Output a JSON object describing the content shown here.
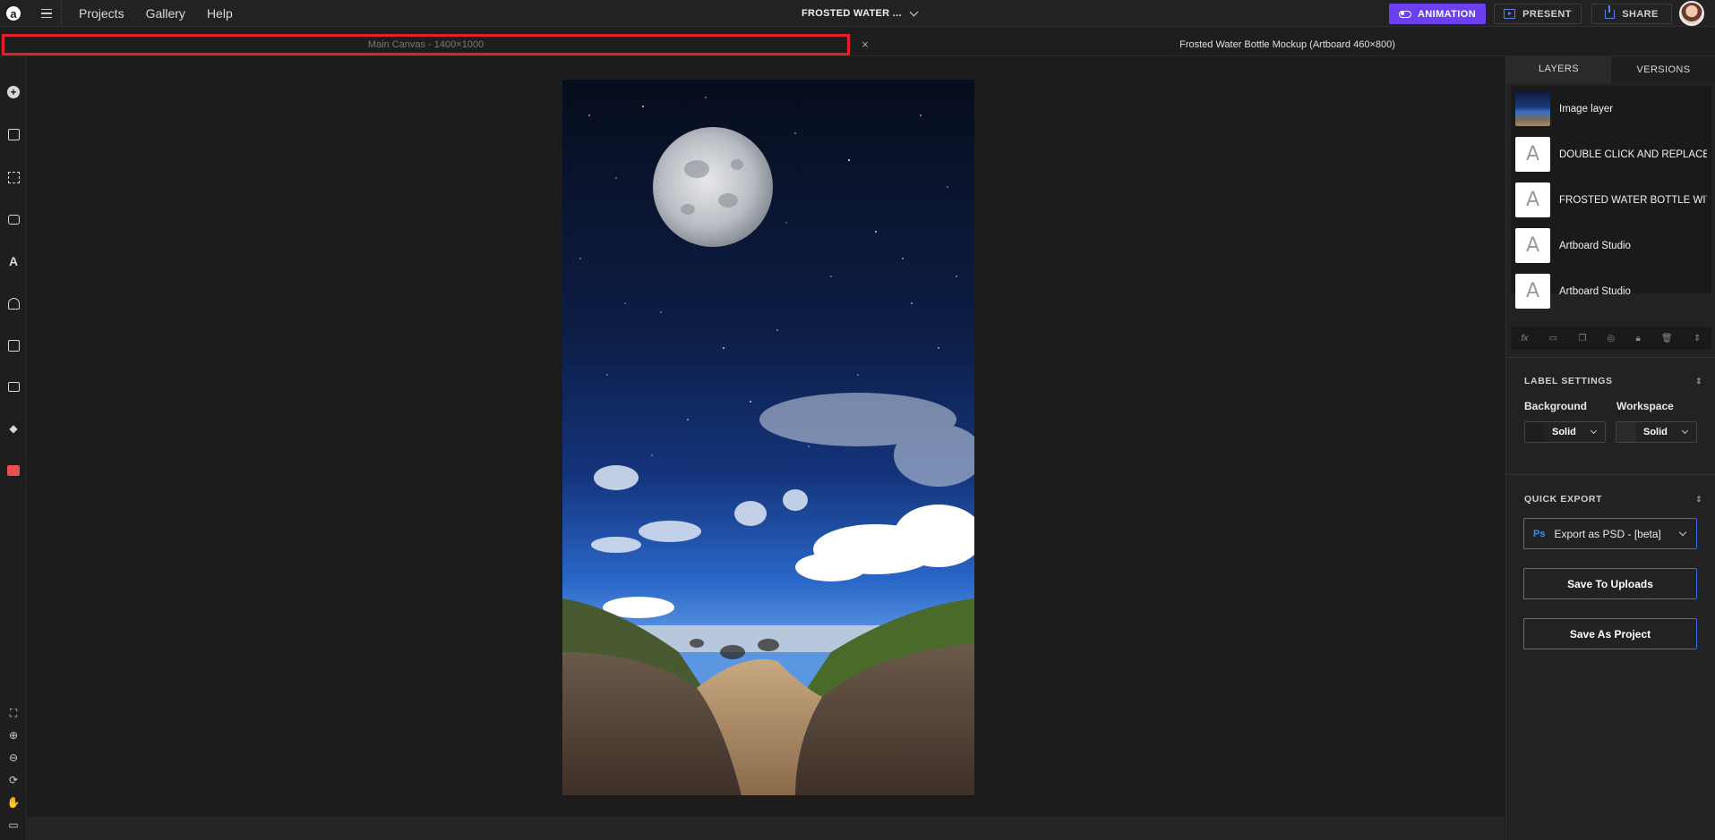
{
  "app": {
    "logo_letter": "a",
    "nav": [
      "Projects",
      "Gallery",
      "Help"
    ],
    "project_title": "FROSTED WATER ...",
    "buttons": {
      "animation": "ANIMATION",
      "present": "PRESENT",
      "share": "SHARE"
    }
  },
  "tabs": {
    "main": "Main Canvas - 1400×1000",
    "close": "×",
    "second": "Frosted Water Bottle Mockup (Artboard 460×800)"
  },
  "right_panel": {
    "tabs": [
      "LAYERS",
      "VERSIONS"
    ],
    "layers": [
      {
        "name": "Image layer",
        "thumb": "image"
      },
      {
        "name": "DOUBLE CLICK AND REPLACE",
        "thumb": "A"
      },
      {
        "name": "FROSTED WATER BOTTLE WITH",
        "thumb": "A"
      },
      {
        "name": "Artboard Studio",
        "thumb": "A"
      },
      {
        "name": "Artboard Studio",
        "thumb": "A"
      }
    ],
    "layer_tools": [
      "fx",
      "folder-icon",
      "duplicate-icon",
      "mask-icon",
      "lock-icon",
      "trash-icon",
      "expand-icon"
    ],
    "label_settings": {
      "title": "LABEL SETTINGS",
      "background_label": "Background",
      "workspace_label": "Workspace",
      "background_value": "Solid",
      "workspace_value": "Solid"
    },
    "quick_export": {
      "title": "QUICK EXPORT",
      "ps_badge": "Ps",
      "export_option": "Export as PSD - [beta]",
      "save_uploads": "Save To Uploads",
      "save_project": "Save As Project"
    }
  },
  "colors": {
    "accent_purple": "#6a40f0",
    "accent_blue": "#3a6cf0",
    "highlight_red": "#e3202a"
  }
}
